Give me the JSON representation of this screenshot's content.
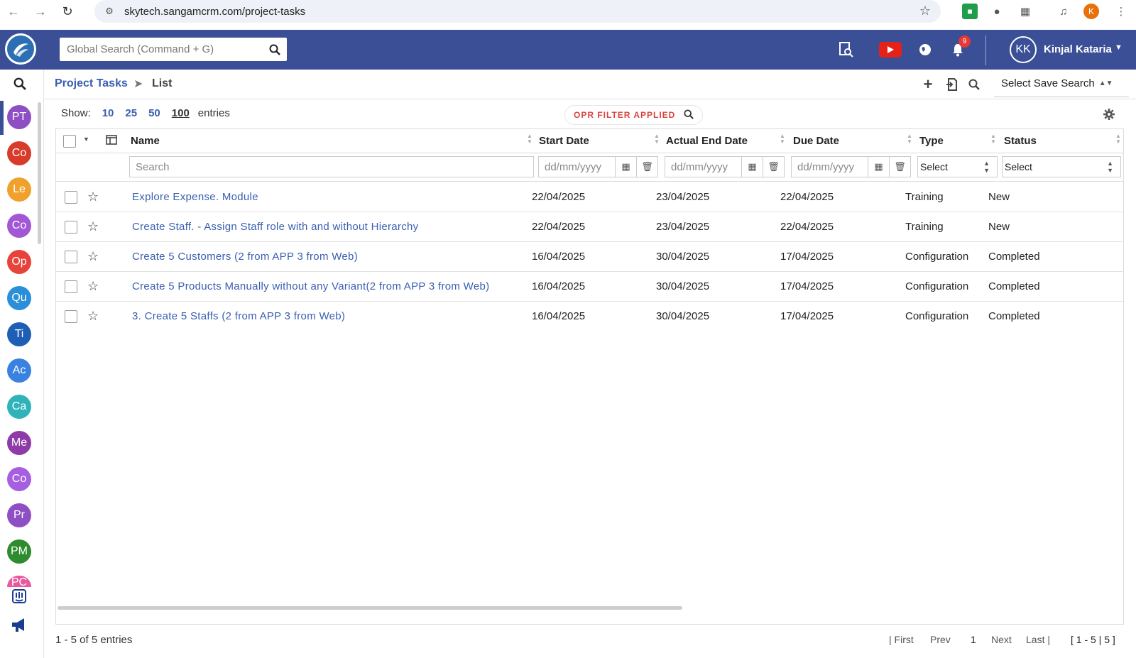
{
  "browser": {
    "url": "skytech.sangamcrm.com/project-tasks",
    "profile_initial": "K"
  },
  "header": {
    "search_placeholder": "Global Search (Command + G)",
    "notification_count": "9",
    "user_initials": "KK",
    "user_name": "Kinjal Kataria"
  },
  "sidebar": {
    "items": [
      {
        "label": "PT",
        "color": "#8e4fc4"
      },
      {
        "label": "Co",
        "color": "#d93b2b"
      },
      {
        "label": "Le",
        "color": "#f0a12b"
      },
      {
        "label": "Co",
        "color": "#a257d6"
      },
      {
        "label": "Op",
        "color": "#e8433b"
      },
      {
        "label": "Qu",
        "color": "#2a8fd8"
      },
      {
        "label": "Ti",
        "color": "#1e5fb5"
      },
      {
        "label": "Ac",
        "color": "#3a82e0"
      },
      {
        "label": "Ca",
        "color": "#2fb3b8"
      },
      {
        "label": "Me",
        "color": "#8e3aa8"
      },
      {
        "label": "Co",
        "color": "#a65fe0"
      },
      {
        "label": "Pr",
        "color": "#8e4fc4"
      },
      {
        "label": "PM",
        "color": "#2e8b2e"
      },
      {
        "label": "PC",
        "color": "#e85aa0"
      }
    ]
  },
  "breadcrumb": {
    "module": "Project Tasks",
    "page": "List"
  },
  "toolbar": {
    "save_search_label": "Select Save Search"
  },
  "show": {
    "label": "Show:",
    "options": [
      "10",
      "25",
      "50",
      "100"
    ],
    "selected": "100",
    "suffix": "entries"
  },
  "filter_badge": "OPR FILTER APPLIED",
  "table": {
    "columns": [
      "Name",
      "Start Date",
      "Actual End Date",
      "Due Date",
      "Type",
      "Status"
    ],
    "filters": {
      "name_placeholder": "Search",
      "date_placeholder": "dd/mm/yyyy",
      "select_label": "Select"
    },
    "rows": [
      {
        "name": "Explore Expense. Module",
        "start": "22/04/2025",
        "actual_end": "23/04/2025",
        "due": "22/04/2025",
        "type": "Training",
        "status": "New"
      },
      {
        "name": "Create Staff. - Assign Staff role with and without Hierarchy",
        "start": "22/04/2025",
        "actual_end": "23/04/2025",
        "due": "22/04/2025",
        "type": "Training",
        "status": "New"
      },
      {
        "name": "Create 5 Customers (2 from APP 3 from Web)",
        "start": "16/04/2025",
        "actual_end": "30/04/2025",
        "due": "17/04/2025",
        "type": "Configuration",
        "status": "Completed"
      },
      {
        "name": "Create 5 Products Manually without any Variant(2 from APP 3 from Web)",
        "start": "16/04/2025",
        "actual_end": "30/04/2025",
        "due": "17/04/2025",
        "type": "Configuration",
        "status": "Completed"
      },
      {
        "name": "3. Create 5 Staffs (2 from APP 3 from Web)",
        "start": "16/04/2025",
        "actual_end": "30/04/2025",
        "due": "17/04/2025",
        "type": "Configuration",
        "status": "Completed"
      }
    ]
  },
  "footer": {
    "summary": "1 - 5 of 5 entries",
    "first": "| First",
    "prev": "Prev",
    "page": "1",
    "next": "Next",
    "last": "Last |",
    "range": "[ 1 - 5 | 5 ]"
  }
}
